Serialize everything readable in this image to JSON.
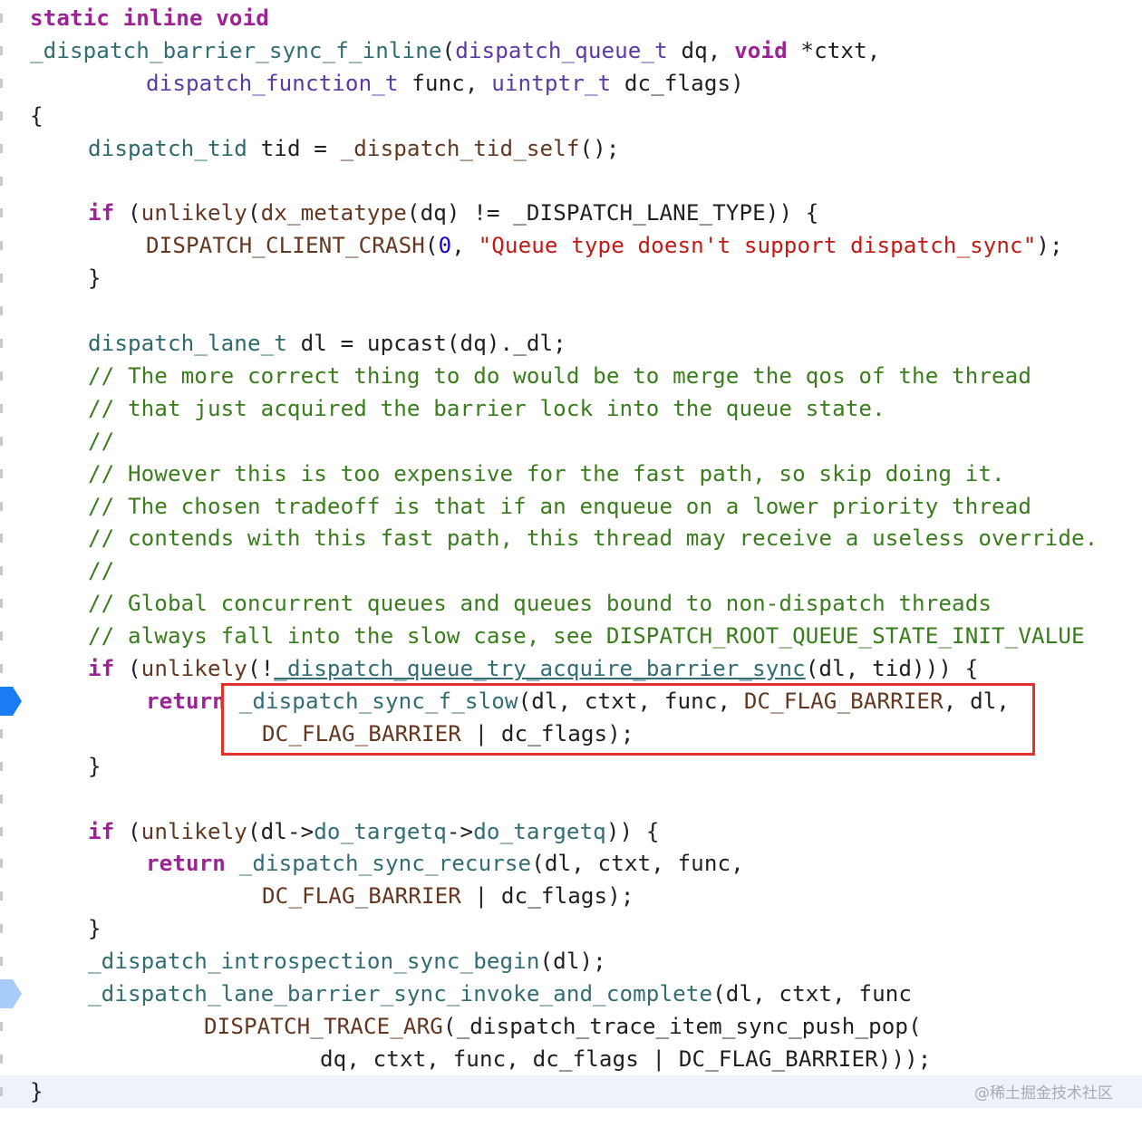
{
  "editor": {
    "colors": {
      "keyword": "#9b2393",
      "function": "#326d74",
      "type": "#5b3aa6",
      "macro": "#643820",
      "number": "#1c00cf",
      "string": "#c41a16",
      "comment": "#3a7d1c",
      "highlight_box": "#e0312b",
      "current_line": "#edf2fb"
    },
    "lines": [
      [
        [
          "static inline void",
          "kw"
        ]
      ],
      [
        [
          "_dispatch_barrier_sync_f_inline",
          "fn"
        ],
        [
          "(",
          "pl"
        ],
        [
          "dispatch_queue_t",
          "ty"
        ],
        [
          " dq, ",
          "pl"
        ],
        [
          "void",
          "kw"
        ],
        [
          " *ctxt,",
          "pl"
        ]
      ],
      [
        [
          "\t\t",
          "pl"
        ],
        [
          "dispatch_function_t",
          "ty"
        ],
        [
          " func, ",
          "pl"
        ],
        [
          "uintptr_t",
          "ty"
        ],
        [
          " dc_flags)",
          "pl"
        ]
      ],
      [
        [
          "{",
          "pl"
        ]
      ],
      [
        [
          "\t",
          "pl"
        ],
        [
          "dispatch_tid",
          "tt"
        ],
        [
          " tid = ",
          "pl"
        ],
        [
          "_dispatch_tid_self",
          "mac"
        ],
        [
          "();",
          "pl"
        ]
      ],
      [],
      [
        [
          "\t",
          "pl"
        ],
        [
          "if",
          "kw"
        ],
        [
          " (",
          "pl"
        ],
        [
          "unlikely",
          "mac"
        ],
        [
          "(",
          "pl"
        ],
        [
          "dx_metatype",
          "mac"
        ],
        [
          "(dq) != _DISPATCH_LANE_TYPE)) {",
          "pl"
        ]
      ],
      [
        [
          "\t\t",
          "pl"
        ],
        [
          "DISPATCH_CLIENT_CRASH",
          "mac"
        ],
        [
          "(",
          "pl"
        ],
        [
          "0",
          "num"
        ],
        [
          ", ",
          "pl"
        ],
        [
          "\"Queue type doesn't support dispatch_sync\"",
          "str"
        ],
        [
          ");",
          "pl"
        ]
      ],
      [
        [
          "\t}",
          "pl"
        ]
      ],
      [],
      [
        [
          "\t",
          "pl"
        ],
        [
          "dispatch_lane_t",
          "tt"
        ],
        [
          " dl = upcast(dq)._dl;",
          "pl"
        ]
      ],
      [
        [
          "\t",
          "pl"
        ],
        [
          "// The more correct thing to do would be to merge the qos of the thread",
          "cm"
        ]
      ],
      [
        [
          "\t",
          "pl"
        ],
        [
          "// that just acquired the barrier lock into the queue state.",
          "cm"
        ]
      ],
      [
        [
          "\t",
          "pl"
        ],
        [
          "//",
          "cm"
        ]
      ],
      [
        [
          "\t",
          "pl"
        ],
        [
          "// However this is too expensive for the fast path, so skip doing it.",
          "cm"
        ]
      ],
      [
        [
          "\t",
          "pl"
        ],
        [
          "// The chosen tradeoff is that if an enqueue on a lower priority thread",
          "cm"
        ]
      ],
      [
        [
          "\t",
          "pl"
        ],
        [
          "// contends with this fast path, this thread may receive a useless override.",
          "cm"
        ]
      ],
      [
        [
          "\t",
          "pl"
        ],
        [
          "//",
          "cm"
        ]
      ],
      [
        [
          "\t",
          "pl"
        ],
        [
          "// Global concurrent queues and queues bound to non-dispatch threads",
          "cm"
        ]
      ],
      [
        [
          "\t",
          "pl"
        ],
        [
          "// always fall into the slow case, see DISPATCH_ROOT_QUEUE_STATE_INIT_VALUE",
          "cm"
        ]
      ],
      [
        [
          "\t",
          "pl"
        ],
        [
          "if",
          "kw"
        ],
        [
          " (",
          "pl"
        ],
        [
          "unlikely",
          "mac"
        ],
        [
          "(!",
          "pl"
        ],
        [
          "_dispatch_queue_try_acquire_barrier_sync",
          "fn ul"
        ],
        [
          "(dl, tid))) {",
          "pl"
        ]
      ],
      [
        [
          "\t\t",
          "pl"
        ],
        [
          "return",
          "kw"
        ],
        [
          " ",
          "pl"
        ],
        [
          "_dispatch_sync_f_slow",
          "fn"
        ],
        [
          "(dl, ctxt, func, ",
          "pl"
        ],
        [
          "DC_FLAG_BARRIER",
          "mac"
        ],
        [
          ", dl,",
          "pl"
        ]
      ],
      [
        [
          "\t\t\t\t",
          "pl"
        ],
        [
          "DC_FLAG_BARRIER",
          "mac"
        ],
        [
          " | dc_flags);",
          "pl"
        ]
      ],
      [
        [
          "\t}",
          "pl"
        ]
      ],
      [],
      [
        [
          "\t",
          "pl"
        ],
        [
          "if",
          "kw"
        ],
        [
          " (",
          "pl"
        ],
        [
          "unlikely",
          "mac"
        ],
        [
          "(dl->",
          "pl"
        ],
        [
          "do_targetq",
          "fn"
        ],
        [
          "->",
          "pl"
        ],
        [
          "do_targetq",
          "fn"
        ],
        [
          ")) {",
          "pl"
        ]
      ],
      [
        [
          "\t\t",
          "pl"
        ],
        [
          "return",
          "kw"
        ],
        [
          " ",
          "pl"
        ],
        [
          "_dispatch_sync_recurse",
          "fn"
        ],
        [
          "(dl, ctxt, func,",
          "pl"
        ]
      ],
      [
        [
          "\t\t\t\t",
          "pl"
        ],
        [
          "DC_FLAG_BARRIER",
          "mac"
        ],
        [
          " | dc_flags);",
          "pl"
        ]
      ],
      [
        [
          "\t}",
          "pl"
        ]
      ],
      [
        [
          "\t",
          "pl"
        ],
        [
          "_dispatch_introspection_sync_begin",
          "fn"
        ],
        [
          "(dl);",
          "pl"
        ]
      ],
      [
        [
          "\t",
          "pl"
        ],
        [
          "_dispatch_lane_barrier_sync_invoke_and_complete",
          "fn"
        ],
        [
          "(dl, ctxt, func",
          "pl"
        ]
      ],
      [
        [
          "\t\t\t",
          "pl"
        ],
        [
          "DISPATCH_TRACE_ARG",
          "mac"
        ],
        [
          "(_dispatch_trace_item_sync_push_pop(",
          "pl"
        ]
      ],
      [
        [
          "\t\t\t\t\t",
          "pl"
        ],
        [
          "dq, ctxt, func, dc_flags | DC_FLAG_BARRIER)));",
          "pl"
        ]
      ],
      [
        [
          "}",
          "pl"
        ]
      ]
    ],
    "breakpoints": [
      {
        "line": 21,
        "state": "active",
        "color": "#1a7cf2"
      },
      {
        "line": 30,
        "state": "disabled",
        "color": "#a9cdfb"
      }
    ],
    "current_line": 33,
    "watermark": "@稀土掘金技术社区"
  }
}
